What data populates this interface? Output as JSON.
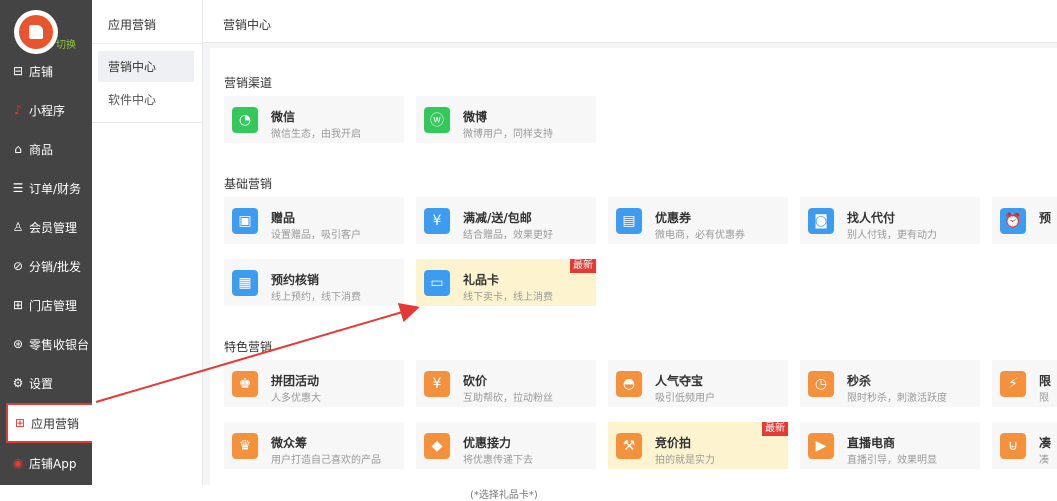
{
  "sidebar": {
    "switch_label": "切换",
    "items": [
      {
        "label": "店铺",
        "icon": "store-icon"
      },
      {
        "label": "小程序",
        "icon": "tiktok-icon"
      },
      {
        "label": "商品",
        "icon": "bag-icon"
      },
      {
        "label": "订单/财务",
        "icon": "order-icon"
      },
      {
        "label": "会员管理",
        "icon": "member-icon"
      },
      {
        "label": "分销/批发",
        "icon": "distribution-icon"
      },
      {
        "label": "门店管理",
        "icon": "shop-icon"
      },
      {
        "label": "零售收银台",
        "icon": "cashier-icon"
      },
      {
        "label": "设置",
        "icon": "gear-icon"
      },
      {
        "label": "应用营销",
        "icon": "grid-icon"
      },
      {
        "label": "店铺App",
        "icon": "app-icon"
      }
    ]
  },
  "subnav": {
    "title": "应用营销",
    "items": [
      {
        "label": "营销中心"
      },
      {
        "label": "软件中心"
      }
    ]
  },
  "breadcrumb": "营销中心",
  "sections": [
    {
      "title": "营销渠道"
    },
    {
      "title": "基础营销"
    },
    {
      "title": "特色营销"
    }
  ],
  "cards": {
    "wechat": {
      "name": "微信",
      "desc": "微信生态，由我开启",
      "icon": "wechat-icon",
      "color": "#34c759"
    },
    "weibo": {
      "name": "微博",
      "desc": "微博用户，同样支持",
      "icon": "weibo-icon",
      "color": "#34c759"
    },
    "gift": {
      "name": "赠品",
      "desc": "设置赠品，吸引客户",
      "icon": "gift-box-icon",
      "color": "#3d9bf0"
    },
    "discount": {
      "name": "满减/送/包邮",
      "desc": "结合赠品，效果更好",
      "icon": "yen-hand-icon",
      "color": "#3d9bf0"
    },
    "coupon": {
      "name": "优惠券",
      "desc": "微电商，必有优惠券",
      "icon": "coupon-icon",
      "color": "#3d9bf0"
    },
    "proxy": {
      "name": "找人代付",
      "desc": "别人付钱，更有动力",
      "icon": "pay-icon",
      "color": "#3d9bf0"
    },
    "alarm": {
      "name": "预",
      "desc": "",
      "icon": "alarm-icon",
      "color": "#3d9bf0"
    },
    "reserve": {
      "name": "预约核销",
      "desc": "线上预约，线下消费",
      "icon": "calendar-icon",
      "color": "#3d9bf0"
    },
    "giftcard": {
      "name": "礼品卡",
      "desc": "线下卖卡，线上消费",
      "icon": "card-icon",
      "color": "#3d9bf0",
      "badge": "最新"
    },
    "groupbuy": {
      "name": "拼团活动",
      "desc": "人多优惠大",
      "icon": "group-icon",
      "color": "#f4913c"
    },
    "bargain": {
      "name": "砍价",
      "desc": "互助帮砍，拉动粉丝",
      "icon": "yen-icon",
      "color": "#f4913c"
    },
    "treasure": {
      "name": "人气夺宝",
      "desc": "吸引低频用户",
      "icon": "treasure-icon",
      "color": "#f4913c"
    },
    "flash": {
      "name": "秒杀",
      "desc": "限时秒杀，刺激活跃度",
      "icon": "clock-icon",
      "color": "#f4913c"
    },
    "limited": {
      "name": "限",
      "desc": "限",
      "icon": "bolt-icon",
      "color": "#f4913c"
    },
    "crowdfund": {
      "name": "微众筹",
      "desc": "用户打造自己喜欢的产品",
      "icon": "crowd-icon",
      "color": "#f4913c"
    },
    "relay": {
      "name": "优惠接力",
      "desc": "将优惠传递下去",
      "icon": "tag-icon",
      "color": "#f4913c"
    },
    "auction": {
      "name": "竞价拍",
      "desc": "拍的就是实力",
      "icon": "gavel-icon",
      "color": "#f4913c",
      "badge": "最新"
    },
    "live": {
      "name": "直播电商",
      "desc": "直播引导，效果明显",
      "icon": "tv-icon",
      "color": "#f4913c"
    },
    "basket": {
      "name": "凑",
      "desc": "凑",
      "icon": "basket-icon",
      "color": "#f4913c"
    }
  },
  "footer": "(*选择礼品卡*)",
  "accent": "#e53935"
}
